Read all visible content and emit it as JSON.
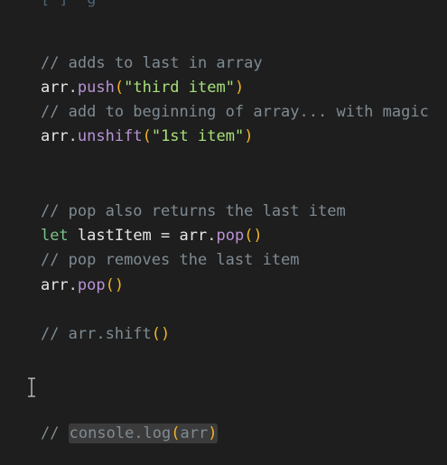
{
  "editor": {
    "partial_top": "    [ ]  g",
    "lines": {
      "l1": "// adds to last in array",
      "l2a": "arr",
      "l2b": ".",
      "l2c": "push",
      "l2d": "(",
      "l2e": "\"third item\"",
      "l2f": ")",
      "l3": "// add to beginning of array... with magic",
      "l4a": "arr",
      "l4b": ".",
      "l4c": "unshift",
      "l4d": "(",
      "l4e": "\"1st item\"",
      "l4f": ")",
      "l5": "// pop also returns the last item",
      "l6a": "let",
      "l6b": " lastItem = ",
      "l6c": "arr",
      "l6d": ".",
      "l6e": "pop",
      "l6f": "()",
      "l7": "// pop removes the last item",
      "l8a": "arr",
      "l8b": ".",
      "l8c": "pop",
      "l8d": "()",
      "l9a": "// arr.shift",
      "l9b": "()",
      "l10a": "// ",
      "l10b": "console.log",
      "l10c": "(",
      "l10d": "arr",
      "l10e": ")"
    }
  }
}
